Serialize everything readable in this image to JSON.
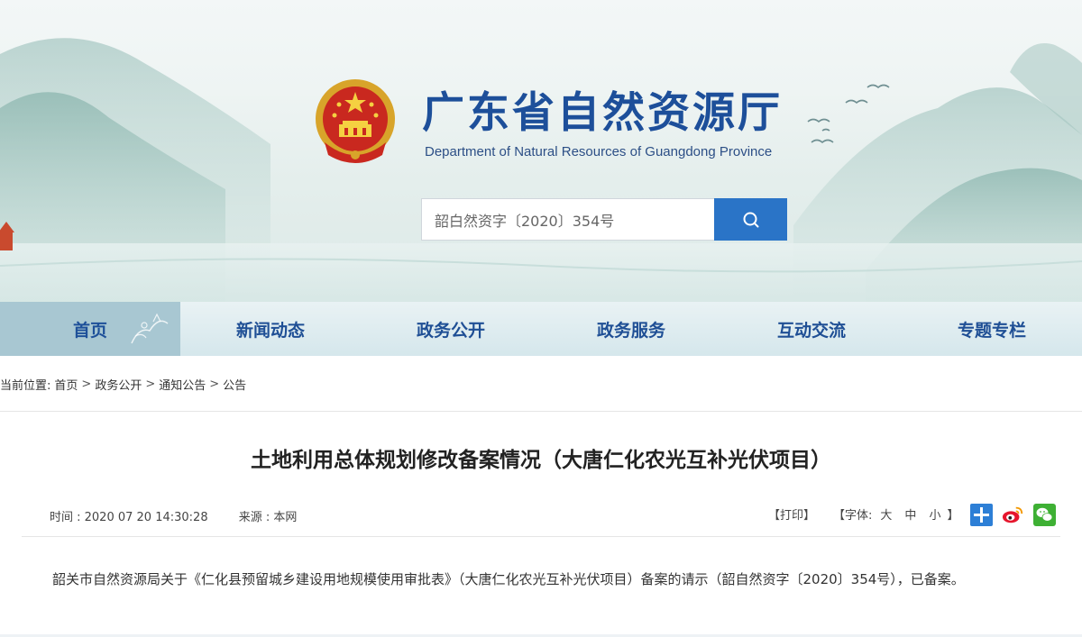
{
  "header": {
    "site_title": "广东省自然资源厅",
    "site_subtitle": "Department of Natural Resources of Guangdong Province",
    "search_value": "韶白然资字〔2020〕354号",
    "search_button_icon": "search-icon"
  },
  "nav": {
    "items": [
      {
        "label": "首页",
        "active": true
      },
      {
        "label": "新闻动态"
      },
      {
        "label": "政务公开"
      },
      {
        "label": "政务服务"
      },
      {
        "label": "互动交流"
      },
      {
        "label": "专题专栏"
      }
    ]
  },
  "breadcrumb": {
    "prefix": "当前位置:",
    "items": [
      "首页",
      "政务公开",
      "通知公告",
      "公告"
    ],
    "separator": ">"
  },
  "article": {
    "title": "土地利用总体规划修改备案情况（大唐仁化农光互补光伏项目）",
    "time_label": "时间 : 2020 07 20 14:30:28",
    "source_label": "来源 : 本网",
    "print_label": "【打印】",
    "font_label": "【字体:",
    "font_sizes": [
      "大",
      "中",
      "小"
    ],
    "font_close": "】",
    "share_icons": [
      "share-plus-icon",
      "weibo-icon",
      "wechat-icon"
    ],
    "body": "韶关市自然资源局关于《仁化县预留城乡建设用地规模使用审批表》（大唐仁化农光互补光伏项目）备案的请示（韶自然资字〔2020〕354号），已备案。"
  },
  "colors": {
    "brand_blue": "#1d4f9a",
    "search_button": "#2a74c7",
    "nav_active": "#a8c7d2"
  }
}
